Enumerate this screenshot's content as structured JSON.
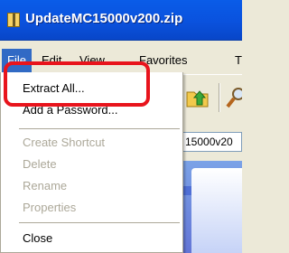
{
  "window": {
    "title": "UpdateMC15000v200.zip"
  },
  "menubar": {
    "items": [
      {
        "label": "File"
      },
      {
        "label": "Edit"
      },
      {
        "label": "View"
      },
      {
        "label": "Favorites"
      },
      {
        "label": "T"
      }
    ]
  },
  "address": {
    "value": "15000v20"
  },
  "file_menu": {
    "extract_all": "Extract All...",
    "add_password": "Add a Password...",
    "create_shortcut": "Create Shortcut",
    "delete": "Delete",
    "rename": "Rename",
    "properties": "Properties",
    "close": "Close"
  },
  "colors": {
    "titlebar": "#0a52de",
    "highlight": "#e8141c",
    "menu_active": "#316ac5"
  },
  "icons": [
    "zip-folder-icon",
    "up-folder-icon",
    "search-icon"
  ]
}
